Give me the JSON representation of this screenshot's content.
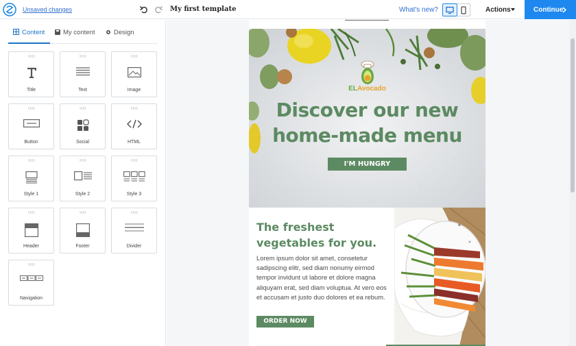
{
  "topbar": {
    "unsaved_label": "Unsaved changes",
    "template_name": "My first template",
    "whats_new": "What's new?",
    "actions_label": "Actions",
    "continue_label": "Continue"
  },
  "sidebar": {
    "tabs": [
      {
        "label": "Content",
        "icon": "grid-icon",
        "active": true
      },
      {
        "label": "My content",
        "icon": "save-icon",
        "active": false
      },
      {
        "label": "Design",
        "icon": "gear-icon",
        "active": false
      }
    ],
    "blocks": [
      {
        "label": "Title",
        "icon": "title-icon"
      },
      {
        "label": "Text",
        "icon": "text-lines-icon"
      },
      {
        "label": "Image",
        "icon": "image-icon"
      },
      {
        "label": "Button",
        "icon": "button-icon"
      },
      {
        "label": "Social",
        "icon": "social-icon"
      },
      {
        "label": "HTML",
        "icon": "code-icon"
      },
      {
        "label": "Style 1",
        "icon": "style1-icon"
      },
      {
        "label": "Style 2",
        "icon": "style2-icon"
      },
      {
        "label": "Style 3",
        "icon": "style3-icon"
      },
      {
        "label": "Header",
        "icon": "header-icon"
      },
      {
        "label": "Footer",
        "icon": "footer-icon"
      },
      {
        "label": "Divider",
        "icon": "divider-icon"
      },
      {
        "label": "Navigation",
        "icon": "navigation-icon"
      }
    ]
  },
  "email": {
    "brand_part1": "EL",
    "brand_part2": "Avocado",
    "headline_line1": "Discover our new",
    "headline_line2": "home-made menu",
    "hero_button": "I'M HUNGRY",
    "section_title_line1": "The freshest",
    "section_title_line2": "vegetables for you.",
    "section_body": "Lorem ipsum dolor sit amet, consetetur sadipscing elitr, sed diam nonumy eirmod tempor invidunt ut labore et dolore magna aliquyam erat, sed diam voluptua. At vero eos et accusam et justo duo dolores et ea rebum.",
    "section_button": "ORDER NOW"
  },
  "colors": {
    "accent_blue": "#1e88f0",
    "brand_green": "#5c8a62",
    "brand_orange": "#e6a32c"
  }
}
